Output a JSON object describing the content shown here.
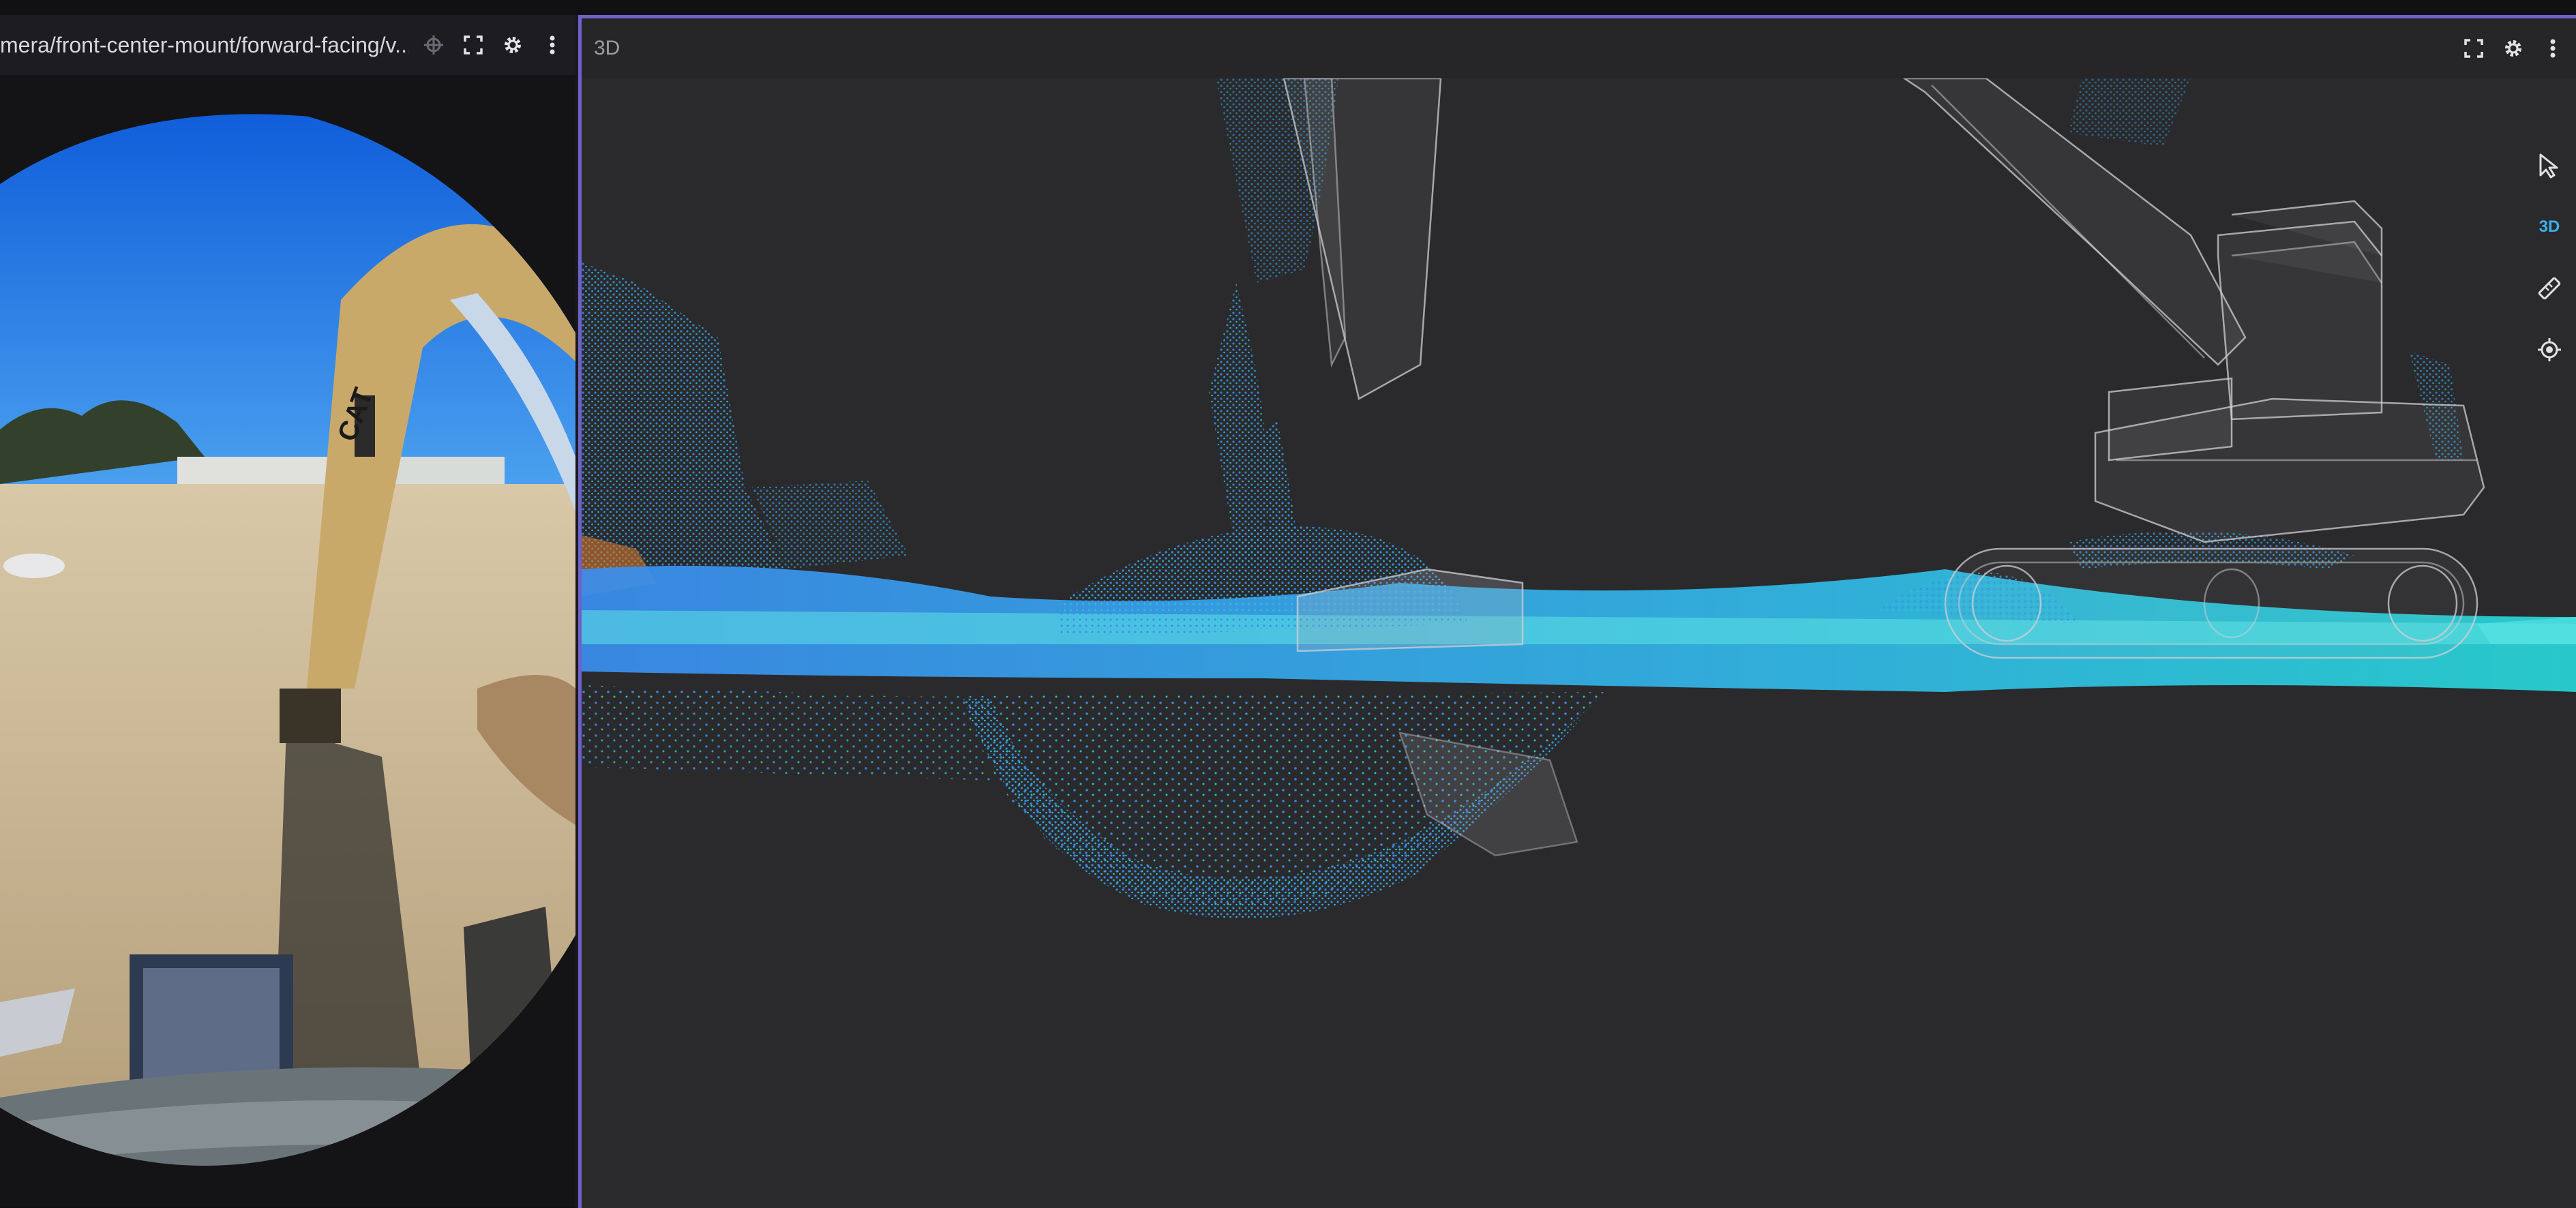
{
  "image_panel": {
    "topic": "mera/front-center-mount/forward-facing/v...",
    "icons": [
      "crosshair-icon",
      "fullscreen-icon",
      "gear-icon",
      "more-vertical-icon"
    ],
    "camera_logo": "CAT"
  },
  "three_d_panel": {
    "title": "3D",
    "icons": [
      "fullscreen-icon",
      "gear-icon",
      "more-vertical-icon"
    ],
    "toolbar": {
      "select_icon": "cursor-arrow-icon",
      "mode_label": "3D",
      "measure_icon": "ruler-icon",
      "publish_icon": "target-icon"
    }
  },
  "colors": {
    "accent_border": "#6e62c8",
    "pointcloud_blue": "#3a8ff0",
    "pointcloud_cyan": "#28d6d8",
    "active_mode": "#3ab0f0"
  }
}
